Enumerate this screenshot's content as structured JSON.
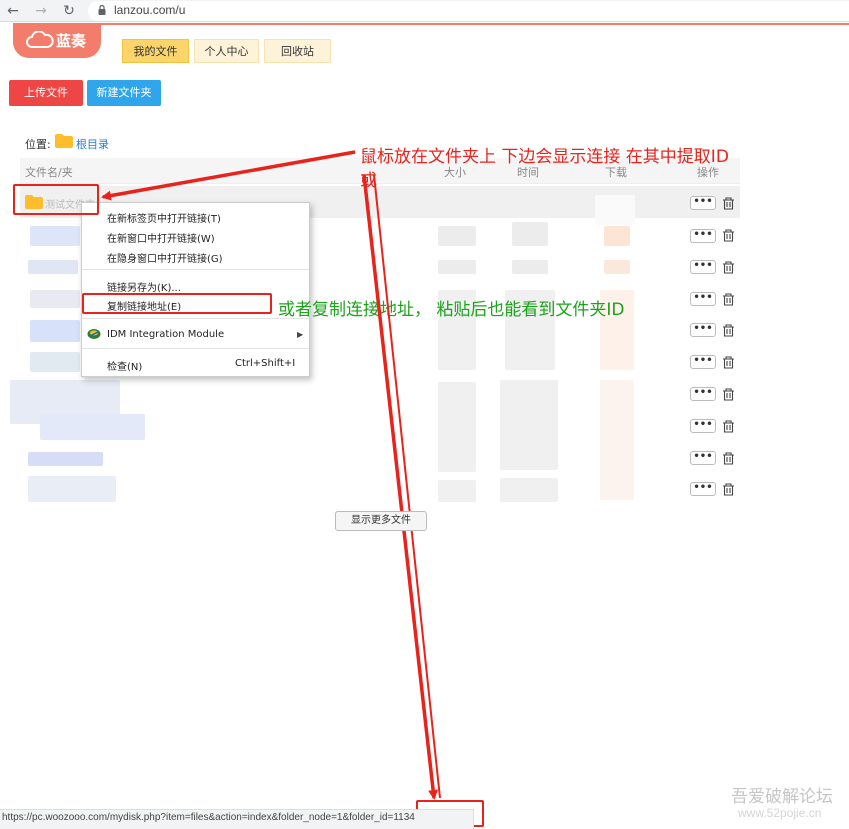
{
  "browser": {
    "url": "lanzou.com/u"
  },
  "app": {
    "logo_text": "蓝奏",
    "tabs": [
      {
        "label": "我的文件",
        "active": true
      },
      {
        "label": "个人中心",
        "active": false
      },
      {
        "label": "回收站",
        "active": false
      }
    ],
    "upload_label": "上传文件",
    "new_folder_label": "新建文件夹"
  },
  "location": {
    "label": "位置:",
    "root": "根目录"
  },
  "table": {
    "headers": [
      "文件名/夹",
      "大小",
      "时间",
      "下载",
      "操作"
    ],
    "first_row_name": "测试文件夹",
    "more_dots": "•••"
  },
  "context_menu": {
    "items": [
      {
        "label": "在新标签页中打开链接(T)"
      },
      {
        "label": "在新窗口中打开链接(W)"
      },
      {
        "label": "在隐身窗口中打开链接(G)"
      },
      {
        "label": "链接另存为(K)..."
      },
      {
        "label": "复制链接地址(E)"
      },
      {
        "label": "IDM Integration Module"
      },
      {
        "label": "检查(N)",
        "shortcut": "Ctrl+Shift+I"
      }
    ]
  },
  "more_files_label": "显示更多文件",
  "status_url": "https://pc.woozooo.com/mydisk.php?item=files&action=index&folder_node=1&folder_id=1134",
  "annotations": {
    "hover_note_line1": "鼠标放在文件夹上  下边会显示连接  在其中提取ID",
    "hover_note_line2": "或",
    "copy_note": "或者复制连接地址， 粘贴后也能看到文件夹ID"
  },
  "watermark": {
    "line1": "吾爱破解论坛",
    "line2": "www.52pojie.cn"
  },
  "colors": {
    "upload": "#ee4545",
    "new_folder": "#2fa5ec",
    "annotation_red": "#e8231b",
    "annotation_green": "#1ca31c",
    "folder": "#fdbd2c"
  }
}
